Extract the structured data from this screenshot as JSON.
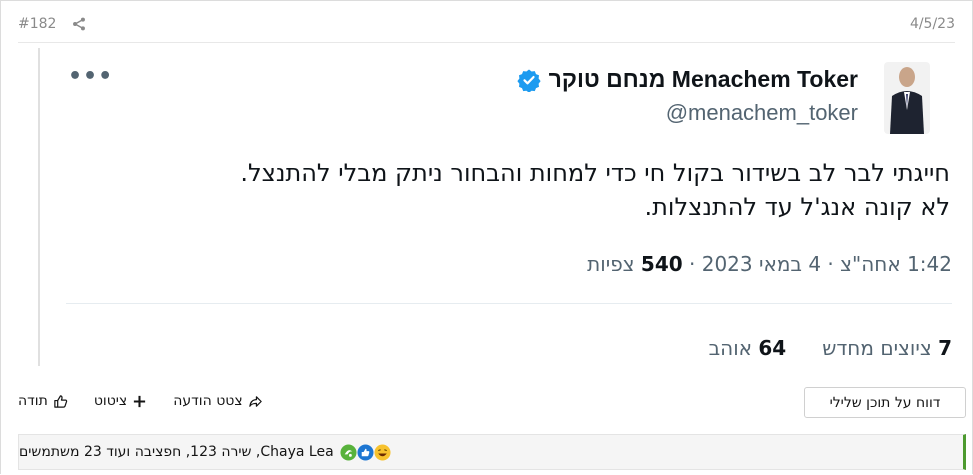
{
  "post": {
    "number": "#182",
    "date": "4/5/23"
  },
  "tweet": {
    "display_name": "Menachem Toker מנחם טוקר",
    "handle": "@menachem_toker",
    "more": "•••",
    "text_line1": "חייגתי לבר לב בשידור בקול חי כדי למחות והבחור ניתק מבלי להתנצל.",
    "text_line2": "לא קונה אנג'ל עד להתנצלות.",
    "meta_time": "1:42 אחה\"צ · 4 במאי 2023 · ",
    "views_count": "540",
    "views_label": "צפיות",
    "retweets_count": "7",
    "retweets_label": "ציוצים מחדש",
    "likes_count": "64",
    "likes_label": "אוהב"
  },
  "actions": {
    "thanks": "תודה",
    "quote": "ציטוט",
    "quote_message": "צטט הודעה",
    "report": "דווח על תוכן שלילי"
  },
  "reactions": {
    "text": "Chaya Lea, שירה 123, חפציבה ועוד 23 משתמשים",
    "icons": [
      "laugh-icon",
      "like-icon",
      "thanks-icon"
    ]
  },
  "colors": {
    "accent_green": "#4d9a2f",
    "verified_blue": "#1d9bf0",
    "muted": "#536471"
  }
}
